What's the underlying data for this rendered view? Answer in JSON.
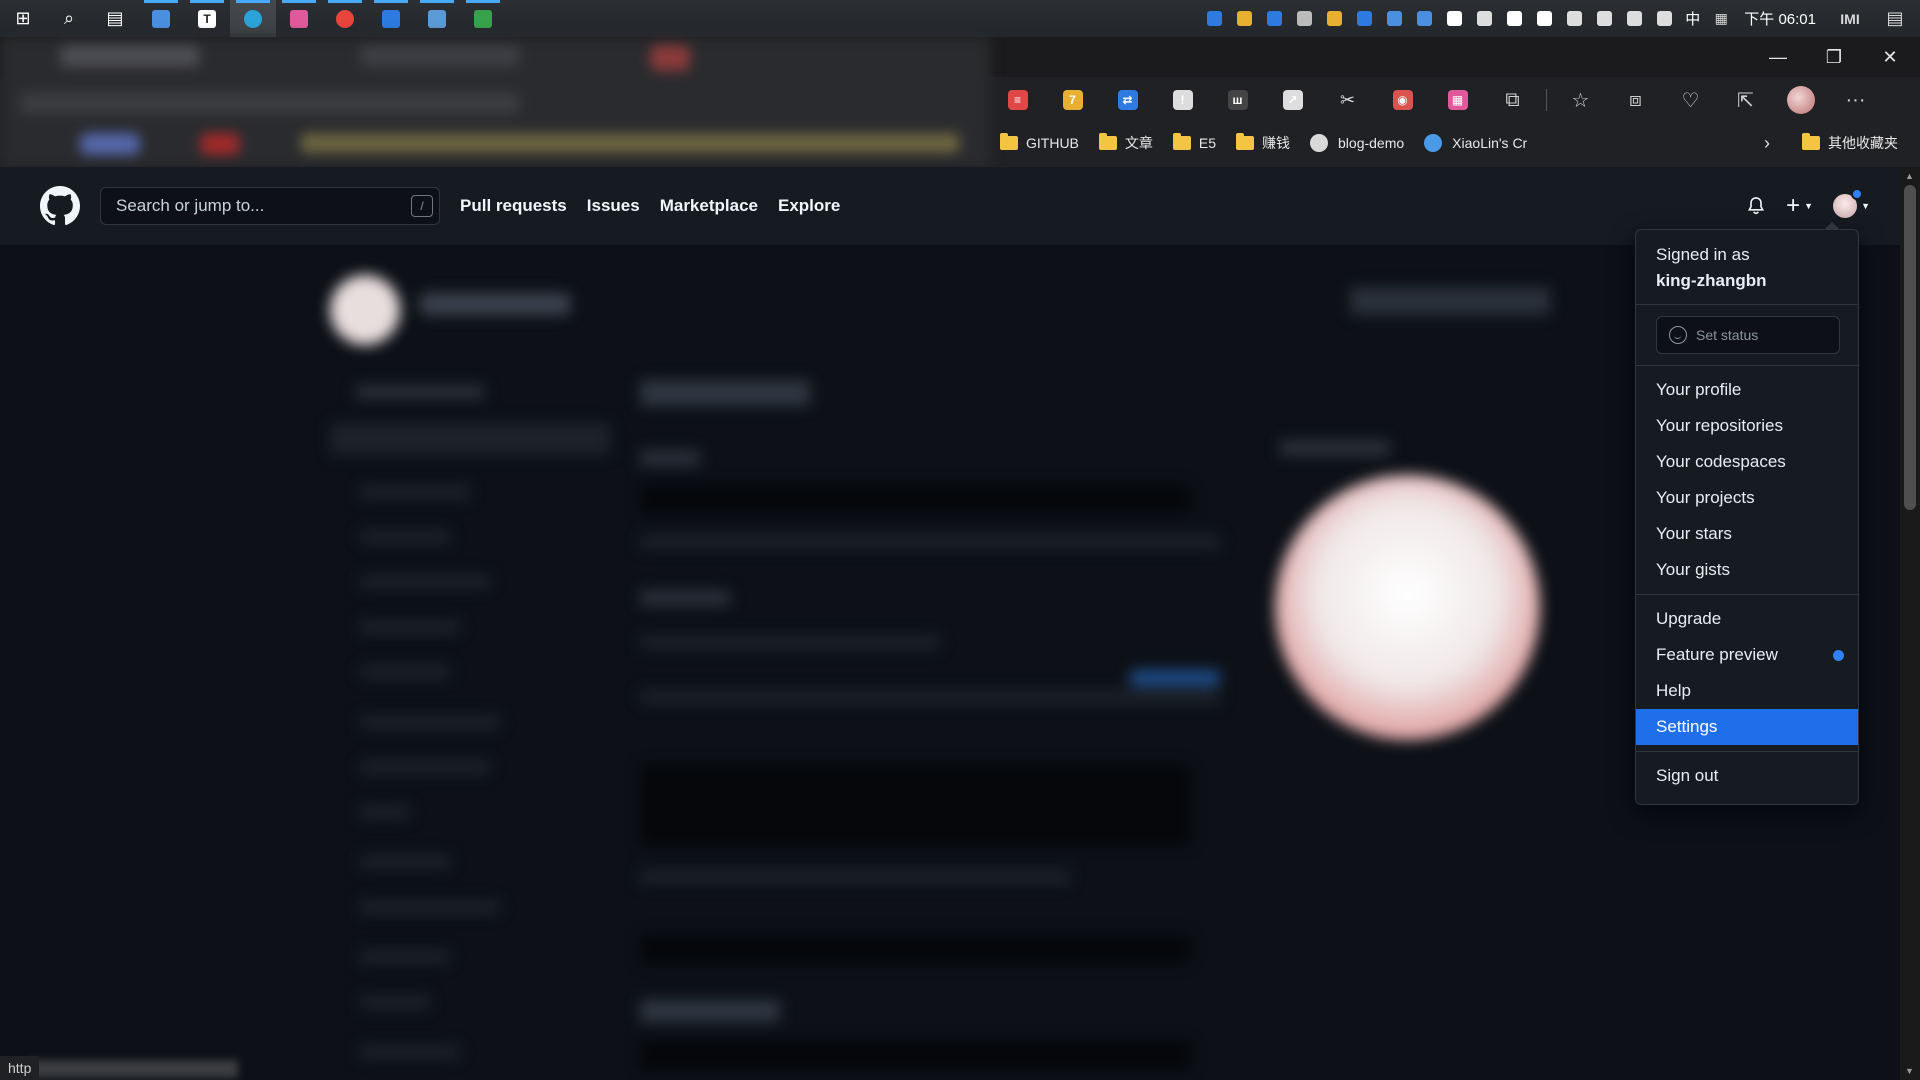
{
  "taskbar": {
    "apps": [
      {
        "name": "windows-start-icon",
        "glyph": "⊞",
        "color": "#ffffff"
      },
      {
        "name": "search-icon",
        "glyph": "⌕",
        "color": "#ffffff"
      },
      {
        "name": "task-view-icon",
        "glyph": "▤",
        "color": "#ffffff"
      },
      {
        "name": "pinned-app-icon",
        "glyph": "",
        "color": "#4a8fe0"
      },
      {
        "name": "typora-icon",
        "glyph": "T",
        "color": "#ffffff"
      },
      {
        "name": "edge-browser-icon",
        "glyph": "",
        "color": "#2aa3d8"
      },
      {
        "name": "pinned-app-icon",
        "glyph": "",
        "color": "#e05a9b"
      },
      {
        "name": "chrome-icon",
        "glyph": "",
        "color": "#e8453c"
      },
      {
        "name": "pinned-app-icon",
        "glyph": "",
        "color": "#2d7be0"
      },
      {
        "name": "pinned-app-icon",
        "glyph": "",
        "color": "#5b9ad6"
      },
      {
        "name": "pinned-app-icon",
        "glyph": "",
        "color": "#37a24a"
      }
    ],
    "tray_icons": [
      "#2d7be0",
      "#e8b030",
      "#2d7be0",
      "#bbbbbb",
      "#e8b030",
      "#2d7be0",
      "#4a8fe0",
      "#4a8fe0",
      "#ffffff",
      "#dddddd",
      "#ffffff",
      "#ffffff",
      "#dddddd",
      "#dddddd",
      "#dddddd",
      "#dddddd"
    ],
    "ime": "中",
    "clock": "下午 06:01",
    "notif_label": "IMI"
  },
  "browser": {
    "window_controls": {
      "minimize": "—",
      "restore": "❐",
      "close": "✕"
    },
    "extensions": [
      {
        "name": "extension-icon",
        "color": "#e04848",
        "glyph": "≡"
      },
      {
        "name": "extension-icon",
        "color": "#e8b030",
        "glyph": "7"
      },
      {
        "name": "extension-icon",
        "color": "#2d7be0",
        "glyph": "⇄"
      },
      {
        "name": "extension-icon",
        "color": "#dddddd",
        "glyph": "!"
      },
      {
        "name": "extension-icon",
        "color": "#444444",
        "glyph": "ш"
      },
      {
        "name": "extension-icon",
        "color": "#dddddd",
        "glyph": "↗"
      },
      {
        "name": "scissors-icon",
        "color": "#00000000",
        "glyph": "✂"
      },
      {
        "name": "extension-icon",
        "color": "#d9534f",
        "glyph": "◉"
      },
      {
        "name": "extension-icon",
        "color": "#e05a9b",
        "glyph": "▦"
      }
    ],
    "bookmarks": [
      {
        "type": "folder",
        "label": "GITHUB"
      },
      {
        "type": "folder",
        "label": "文章"
      },
      {
        "type": "folder",
        "label": "E5"
      },
      {
        "type": "folder",
        "label": "赚钱"
      },
      {
        "type": "site",
        "label": "blog-demo",
        "color": "#d9d9d9"
      },
      {
        "type": "site",
        "label": "XiaoLin's Cr",
        "color": "#4a9ae8"
      }
    ],
    "other_bookmarks": "其他收藏夹",
    "status_url": "http"
  },
  "github": {
    "search_placeholder": "Search or jump to...",
    "search_shortcut": "/",
    "nav": [
      "Pull requests",
      "Issues",
      "Marketplace",
      "Explore"
    ],
    "plus_glyph": "+",
    "menu": {
      "signed_in_label": "Signed in as",
      "username": "king-zhangbn",
      "set_status": "Set status",
      "group1": [
        "Your profile",
        "Your repositories",
        "Your codespaces",
        "Your projects",
        "Your stars",
        "Your gists"
      ],
      "group2": [
        "Upgrade",
        "Feature preview",
        "Help",
        "Settings"
      ],
      "selected": "Settings",
      "sign_out": "Sign out"
    }
  }
}
